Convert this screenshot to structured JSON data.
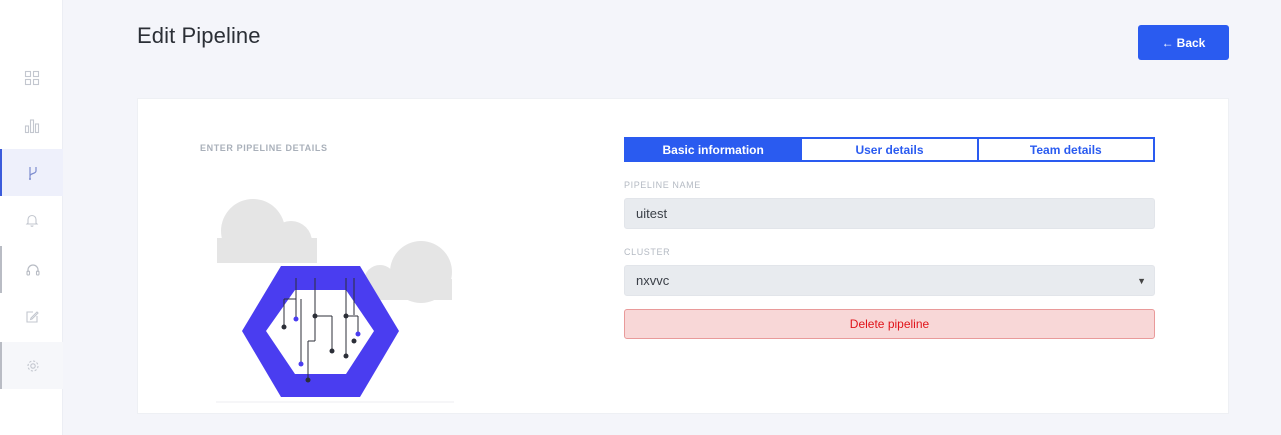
{
  "header": {
    "title": "Edit Pipeline",
    "back_label": "Back"
  },
  "sidebar": {
    "items": [
      {
        "icon": "grid-icon",
        "active": false
      },
      {
        "icon": "bar-chart-icon",
        "active": false
      },
      {
        "icon": "branch-icon",
        "active": true
      },
      {
        "icon": "bell-icon",
        "active": false
      },
      {
        "icon": "headset-icon",
        "active": false
      },
      {
        "icon": "edit-icon",
        "active": false
      },
      {
        "icon": "gear-icon",
        "active": false
      }
    ]
  },
  "form": {
    "heading": "ENTER PIPELINE DETAILS",
    "tabs": [
      {
        "label": "Basic information",
        "active": true
      },
      {
        "label": "User details",
        "active": false
      },
      {
        "label": "Team details",
        "active": false
      }
    ],
    "pipeline_name_label": "PIPELINE NAME",
    "pipeline_name_value": "uitest",
    "cluster_label": "CLUSTER",
    "cluster_value": "nxvvc",
    "delete_label": "Delete pipeline"
  },
  "colors": {
    "accent": "#2a5bf0",
    "hexagon": "#4a3df0",
    "danger_text": "#e0141a",
    "danger_bg": "#f8d7d7"
  }
}
